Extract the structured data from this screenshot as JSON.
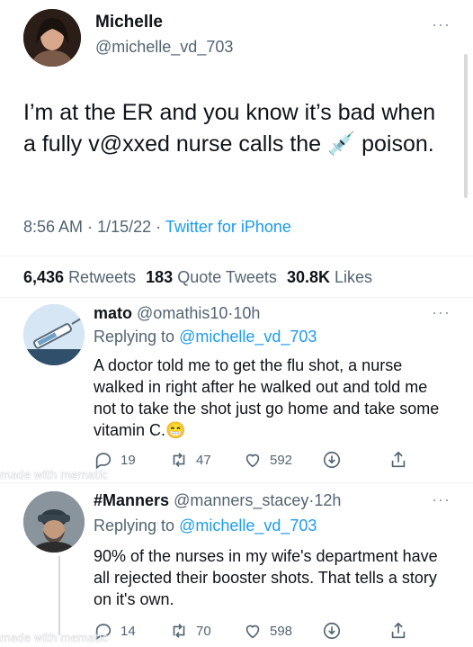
{
  "main_tweet": {
    "name": "Michelle",
    "handle": "@michelle_vd_703",
    "text": "I’m at the ER and you know it’s bad when a fully v@xxed nurse calls the 💉 poison.",
    "time": "8:56 AM",
    "date": "1/15/22",
    "sep": "·",
    "client": "Twitter for iPhone",
    "stats": {
      "retweets_count": "6,436",
      "retweets_label": "Retweets",
      "quotes_count": "183",
      "quotes_label": "Quote Tweets",
      "likes_count": "30.8K",
      "likes_label": "Likes"
    }
  },
  "replies": [
    {
      "name": "mato",
      "handle": "@omathis10",
      "sep": "·",
      "time": "10h",
      "replying_prefix": "Replying to",
      "replying_to": "@michelle_vd_703",
      "text": "A doctor told me to get the flu shot, a nurse walked in right after he walked out and told me not to take the shot just go home and take some vitamin C.😁",
      "replies": "19",
      "retweets": "47",
      "likes": "592"
    },
    {
      "name": "#Manners",
      "handle": "@manners_stacey",
      "sep": "·",
      "time": "12h",
      "replying_prefix": "Replying to",
      "replying_to": "@michelle_vd_703",
      "text": "90% of the nurses in my wife's department have all rejected their booster shots. That tells a story on it's own.",
      "replies": "14",
      "retweets": "70",
      "likes": "598"
    }
  ],
  "watermark": "made with mematic",
  "colors": {
    "link": "#1d9bf0",
    "muted": "#536471",
    "text": "#0f1419"
  }
}
